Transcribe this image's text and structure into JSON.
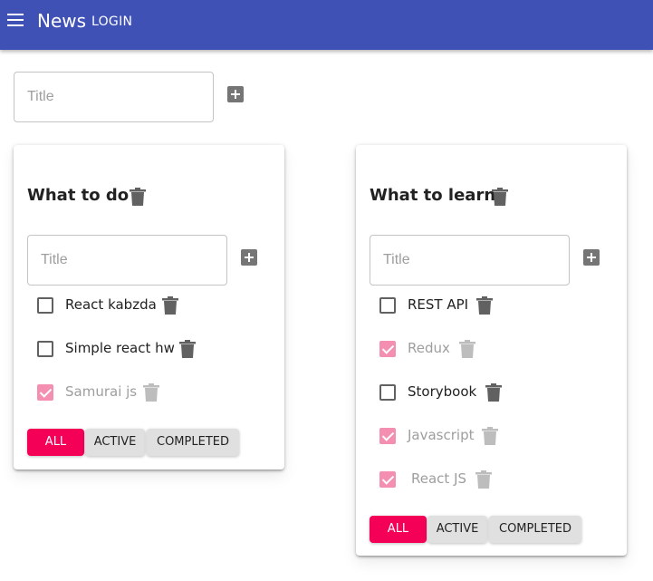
{
  "header": {
    "title": "News",
    "login_label": "LOGIN"
  },
  "new_list": {
    "placeholder": "Title"
  },
  "lists": [
    {
      "title": "What to do",
      "input_placeholder": "Title",
      "tasks": [
        {
          "text": "React kabzda",
          "done": false
        },
        {
          "text": "Simple react hw",
          "done": false
        },
        {
          "text": "Samurai js",
          "done": true
        }
      ],
      "filters": [
        "ALL",
        "ACTIVE",
        "COMPLETED"
      ],
      "active_filter": "ALL"
    },
    {
      "title": "What to learn",
      "input_placeholder": "Title",
      "tasks": [
        {
          "text": "REST API",
          "done": false
        },
        {
          "text": "Redux",
          "done": true
        },
        {
          "text": "Storybook",
          "done": false
        },
        {
          "text": "Javascript",
          "done": true
        },
        {
          "text": "React JS",
          "done": true
        }
      ],
      "filters": [
        "ALL",
        "ACTIVE",
        "COMPLETED"
      ],
      "active_filter": "ALL"
    }
  ],
  "colors": {
    "appbar": "#3f51b5",
    "accent": "#f50057",
    "checked": "#f48fb1"
  }
}
